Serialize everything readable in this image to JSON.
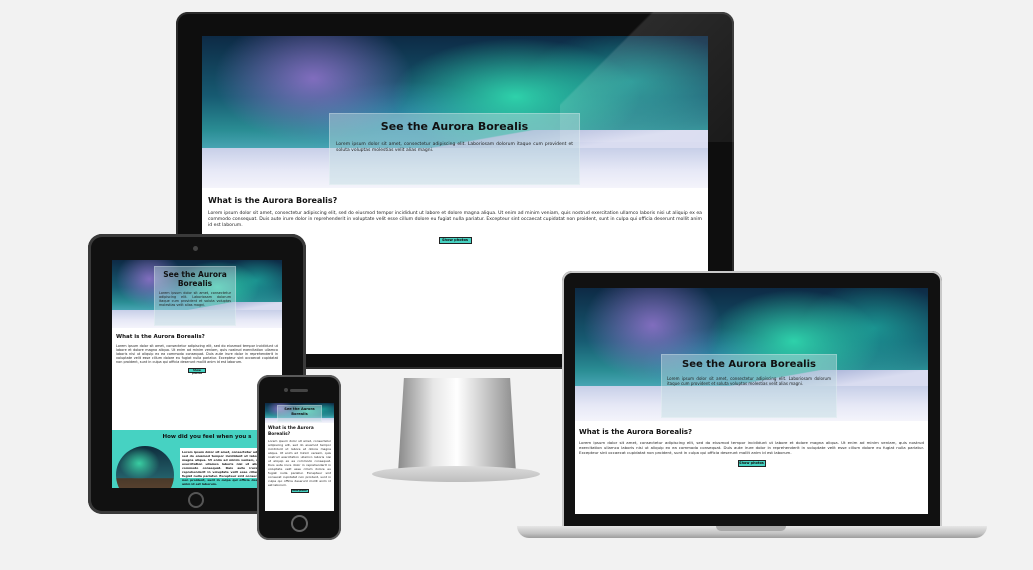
{
  "site": {
    "hero_title": "See the Aurora Borealis",
    "hero_text": "Lorem ipsum dolor sit amet, consectetur adipiscing elit. Laboriosam dolorum itaque cum provident et soluta voluptas molestias velit alias magni.",
    "article_heading": "What is the Aurora Borealis?",
    "article_text": "Lorem ipsum dolor sit amet, consectetur adipiscing elit, sed do eiusmod tempor incididunt ut labore et dolore magna aliqua. Ut enim ad minim veniam, quis nostrud exercitation ullamco laboris nisi ut aliquip ex ea commodo consequat. Duis aute irure dolor in reprehenderit in voluptate velit esse cillum dolore eu fugiat nulla pariatur. Excepteur sint occaecat cupidatat non proident, sunt in culpa qui officia deserunt mollit anim id est laborum.",
    "button_label": "Show photos",
    "feedback_heading": "How did you feel when you s",
    "tablet_hero_title": "See the Aurora Borealis",
    "phone_hero_title": "See the Aurora Borealis"
  },
  "colors": {
    "accent": "#46d2c2",
    "device_black": "#111111",
    "background": "#f2f2f2"
  }
}
